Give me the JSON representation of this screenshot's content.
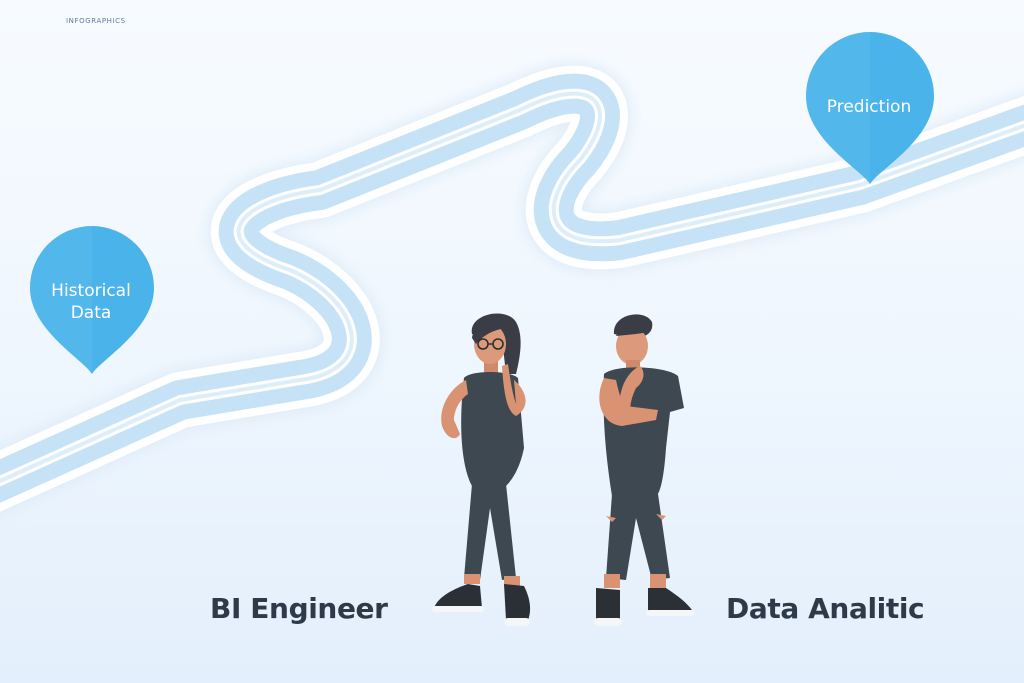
{
  "header": {
    "brand": "INFOGRAPHICS"
  },
  "markers": {
    "historical": {
      "line1": "Historical",
      "line2": "Data"
    },
    "prediction": {
      "label": "Prediction"
    }
  },
  "people": {
    "left_role": "BI Engineer",
    "right_role": "Data Analitic"
  },
  "colors": {
    "pin": "#4ab3ea",
    "road": "#cfe7f8",
    "road_edge": "#ffffff",
    "figure_clothing": "#3e4850",
    "skin": "#d99373",
    "text_dark": "#2e3a47"
  }
}
